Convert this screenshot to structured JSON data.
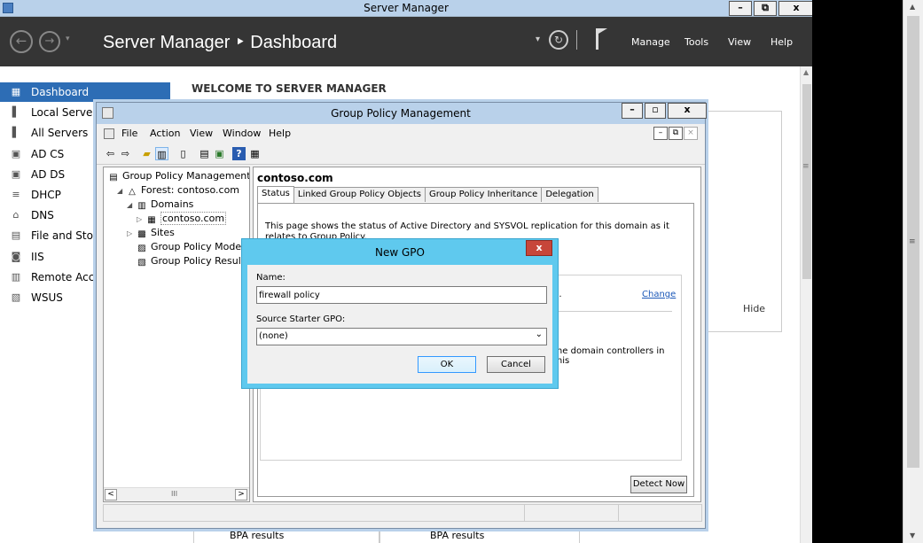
{
  "server_manager": {
    "title": "Server Manager",
    "breadcrumb": "Server Manager ‣ Dashboard",
    "nav_back": "←",
    "nav_forward": "→",
    "menu": [
      "Manage",
      "Tools",
      "View",
      "Help"
    ],
    "window_buttons": {
      "minimize": "–",
      "restore": "⧉",
      "close": "x"
    },
    "sidebar": [
      {
        "label": "Dashboard",
        "icon": "dashboard-icon",
        "glyph": "▦",
        "active": true
      },
      {
        "label": "Local Server",
        "icon": "server-icon",
        "glyph": "▌"
      },
      {
        "label": "All Servers",
        "icon": "servers-icon",
        "glyph": "▌"
      },
      {
        "label": "AD CS",
        "icon": "certificate-icon",
        "glyph": "▣"
      },
      {
        "label": "AD DS",
        "icon": "directory-icon",
        "glyph": "▣"
      },
      {
        "label": "DHCP",
        "icon": "dhcp-icon",
        "glyph": "≡"
      },
      {
        "label": "DNS",
        "icon": "dns-icon",
        "glyph": "⌂"
      },
      {
        "label": "File and Stora",
        "icon": "storage-icon",
        "glyph": "▤"
      },
      {
        "label": "IIS",
        "icon": "iis-icon",
        "glyph": "◙"
      },
      {
        "label": "Remote Acce",
        "icon": "remote-access-icon",
        "glyph": "▥"
      },
      {
        "label": "WSUS",
        "icon": "wsus-icon",
        "glyph": "▧"
      }
    ],
    "welcome": "WELCOME TO SERVER MANAGER",
    "hide": "Hide",
    "bpa": [
      "BPA results",
      "BPA results"
    ]
  },
  "gpm": {
    "title": "Group Policy Management",
    "menu": [
      "File",
      "Action",
      "View",
      "Window",
      "Help"
    ],
    "tree": [
      {
        "label": "Group Policy Management",
        "depth": 0,
        "icon": "gpm-icon",
        "glyph": "▤",
        "exp": ""
      },
      {
        "label": "Forest: contoso.com",
        "depth": 1,
        "icon": "forest-icon",
        "glyph": "△",
        "exp": "◢"
      },
      {
        "label": "Domains",
        "depth": 2,
        "icon": "domains-icon",
        "glyph": "▥",
        "exp": "◢"
      },
      {
        "label": "contoso.com",
        "depth": 3,
        "icon": "domain-icon",
        "glyph": "▦",
        "exp": "▷",
        "selected": true
      },
      {
        "label": "Sites",
        "depth": 2,
        "icon": "sites-icon",
        "glyph": "▩",
        "exp": "▷"
      },
      {
        "label": "Group Policy Modelin",
        "depth": 2,
        "icon": "modeling-icon",
        "glyph": "▨",
        "exp": ""
      },
      {
        "label": "Group Policy Results",
        "depth": 2,
        "icon": "results-icon",
        "glyph": "▧",
        "exp": ""
      }
    ],
    "tree_scroll": {
      "left": "<",
      "thumb": "III",
      "right": ">"
    },
    "heading": "contoso.com",
    "tabs": [
      "Status",
      "Linked Group Policy Objects",
      "Group Policy Inheritance",
      "Delegation"
    ],
    "status_text": "This page shows the status of Active Directory and SYSVOL replication for this domain as it relates to Group Policy.",
    "fragment_n": "n.",
    "change": "Change",
    "fragment_dc": "the domain controllers in this",
    "detect_now": "Detect Now"
  },
  "dialog": {
    "title": "New GPO",
    "close": "x",
    "name_label": "Name:",
    "name_value": "firewall policy",
    "starter_label": "Source Starter GPO:",
    "starter_value": "(none)",
    "ok": "OK",
    "cancel": "Cancel"
  },
  "colors": {
    "active_item": "#2d6db5",
    "header_bg": "#353535",
    "dialog_frame": "#5fc9ee",
    "close_red": "#c7463a",
    "link": "#1b58b8"
  }
}
